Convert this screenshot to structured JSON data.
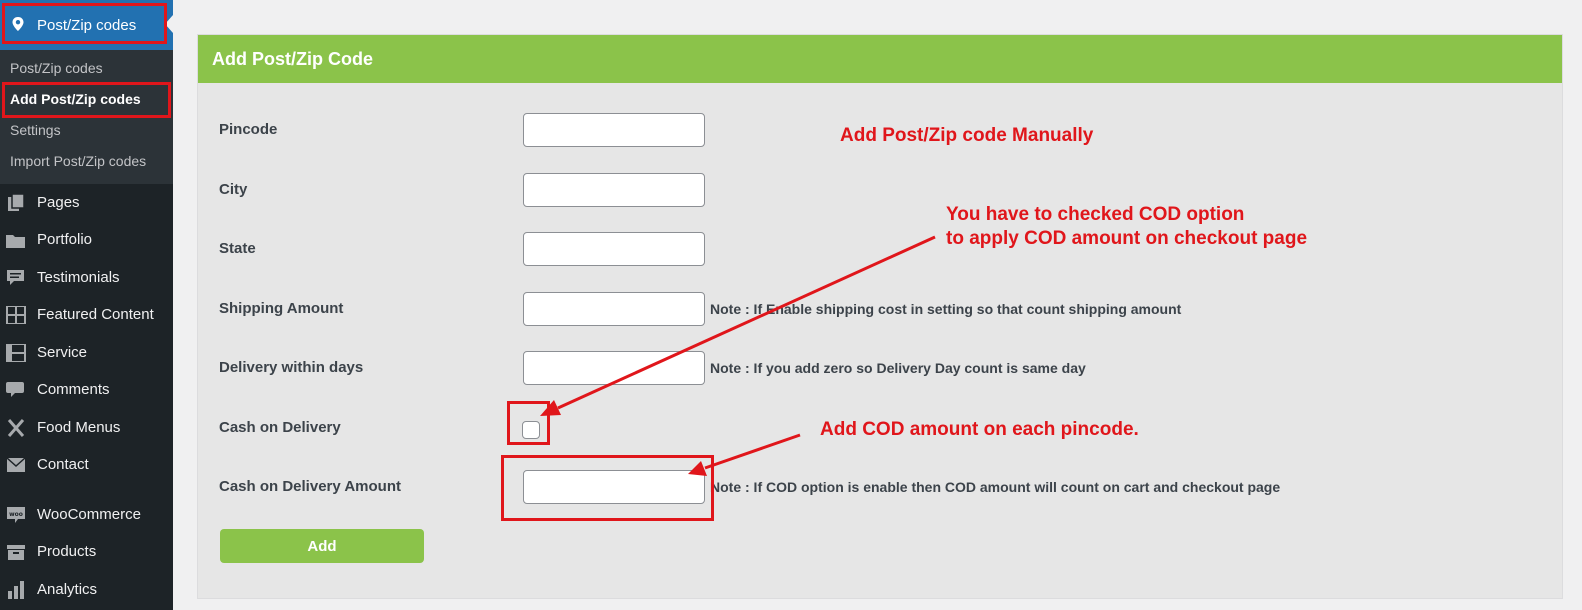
{
  "sidebar": {
    "active_menu": "Post/Zip codes",
    "submenu": [
      {
        "label": "Post/Zip codes",
        "active": false
      },
      {
        "label": "Add Post/Zip codes",
        "active": true
      },
      {
        "label": "Settings",
        "active": false
      },
      {
        "label": "Import Post/Zip codes",
        "active": false
      }
    ],
    "items": [
      {
        "label": "Pages",
        "icon": "pages-icon"
      },
      {
        "label": "Portfolio",
        "icon": "folder-icon"
      },
      {
        "label": "Testimonials",
        "icon": "testimonials-icon"
      },
      {
        "label": "Featured Content",
        "icon": "grid-icon"
      },
      {
        "label": "Service",
        "icon": "service-icon"
      },
      {
        "label": "Comments",
        "icon": "comments-icon"
      },
      {
        "label": "Food Menus",
        "icon": "food-menus-icon"
      },
      {
        "label": "Contact",
        "icon": "envelope-icon"
      },
      {
        "label": "WooCommerce",
        "icon": "woocommerce-icon"
      },
      {
        "label": "Products",
        "icon": "products-icon"
      },
      {
        "label": "Analytics",
        "icon": "analytics-icon"
      }
    ]
  },
  "form": {
    "title": "Add Post/Zip Code",
    "fields": {
      "pincode": {
        "label": "Pincode",
        "value": ""
      },
      "city": {
        "label": "City",
        "value": ""
      },
      "state": {
        "label": "State",
        "value": ""
      },
      "shipping_amount": {
        "label": "Shipping Amount",
        "value": "",
        "note": "Note : If Enable shipping cost in setting so that count shipping amount"
      },
      "delivery_days": {
        "label": "Delivery within days",
        "value": "",
        "note": "Note : If you add zero so Delivery Day count is same day"
      },
      "cod": {
        "label": "Cash on Delivery",
        "checked": false
      },
      "cod_amount": {
        "label": "Cash on Delivery Amount",
        "value": "",
        "note": "Note : If COD option is enable then COD amount will count on cart and checkout page"
      }
    },
    "submit_label": "Add"
  },
  "annotations": {
    "manual": "Add Post/Zip code Manually",
    "cod_line1": "You have to checked COD option",
    "cod_line2": "to apply COD amount on checkout page",
    "cod_amount": "Add COD amount on each pincode."
  },
  "colors": {
    "sidebar_bg": "#1d2327",
    "active_menu_bg": "#2271b1",
    "header_green": "#8bc34a",
    "annotation_red": "#e0161b"
  }
}
